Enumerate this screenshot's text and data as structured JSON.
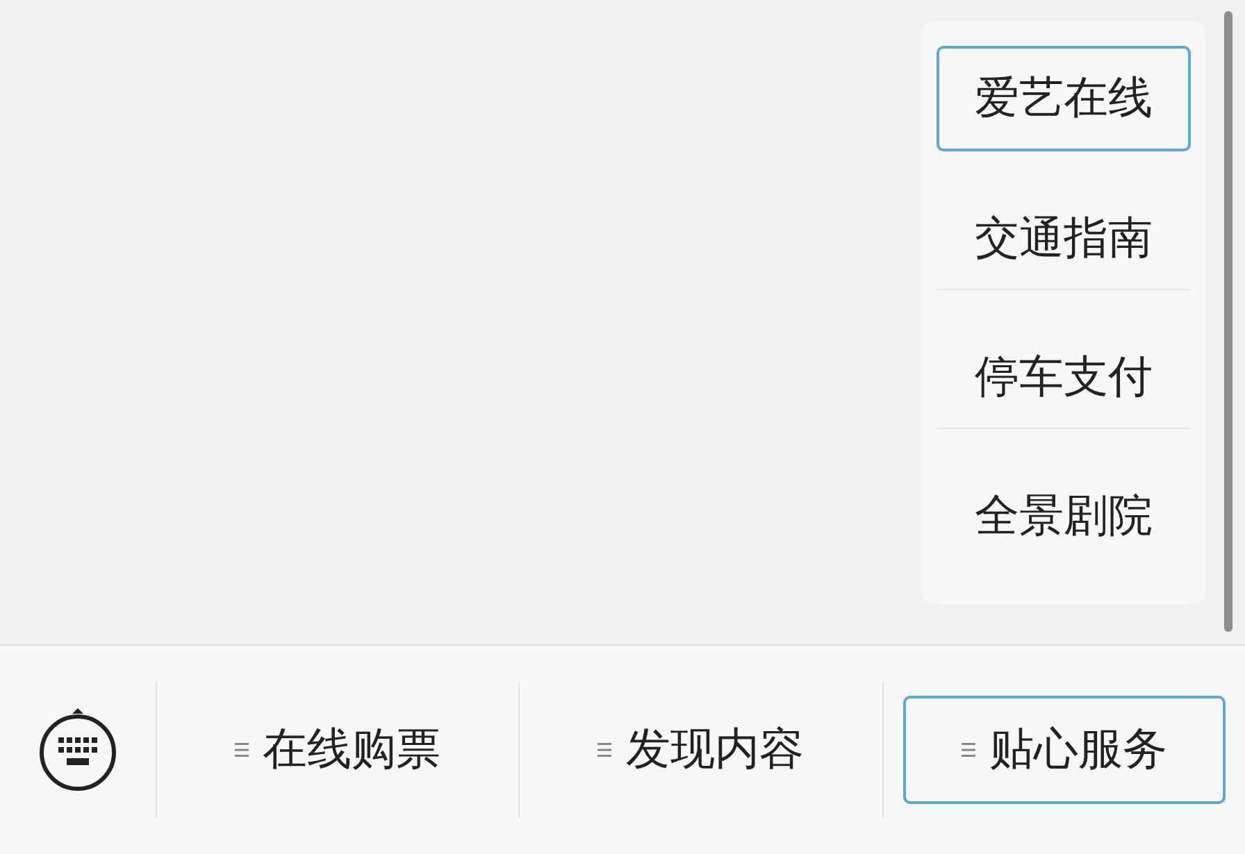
{
  "popup_menu": {
    "items": [
      {
        "label": "爱艺在线",
        "selected": true
      },
      {
        "label": "交通指南",
        "selected": false
      },
      {
        "label": "停车支付",
        "selected": false
      },
      {
        "label": "全景剧院",
        "selected": false
      }
    ]
  },
  "menu_bar": {
    "items": [
      {
        "label": "在线购票",
        "selected": false
      },
      {
        "label": "发现内容",
        "selected": false
      },
      {
        "label": "贴心服务",
        "selected": true
      }
    ]
  }
}
